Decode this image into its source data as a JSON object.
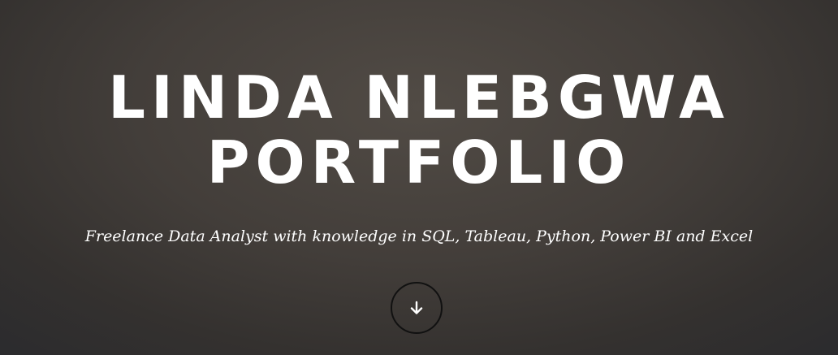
{
  "hero": {
    "title_line_1": "LINDA NLEBGWA",
    "title_line_2": "PORTFOLIO",
    "tagline": "Freelance Data Analyst with knowledge in SQL, Tableau, Python, Power BI and Excel",
    "scroll_icon": "arrow-down-icon"
  },
  "colors": {
    "background": "#433e3a",
    "text": "#ffffff",
    "button_border": "#111111"
  }
}
